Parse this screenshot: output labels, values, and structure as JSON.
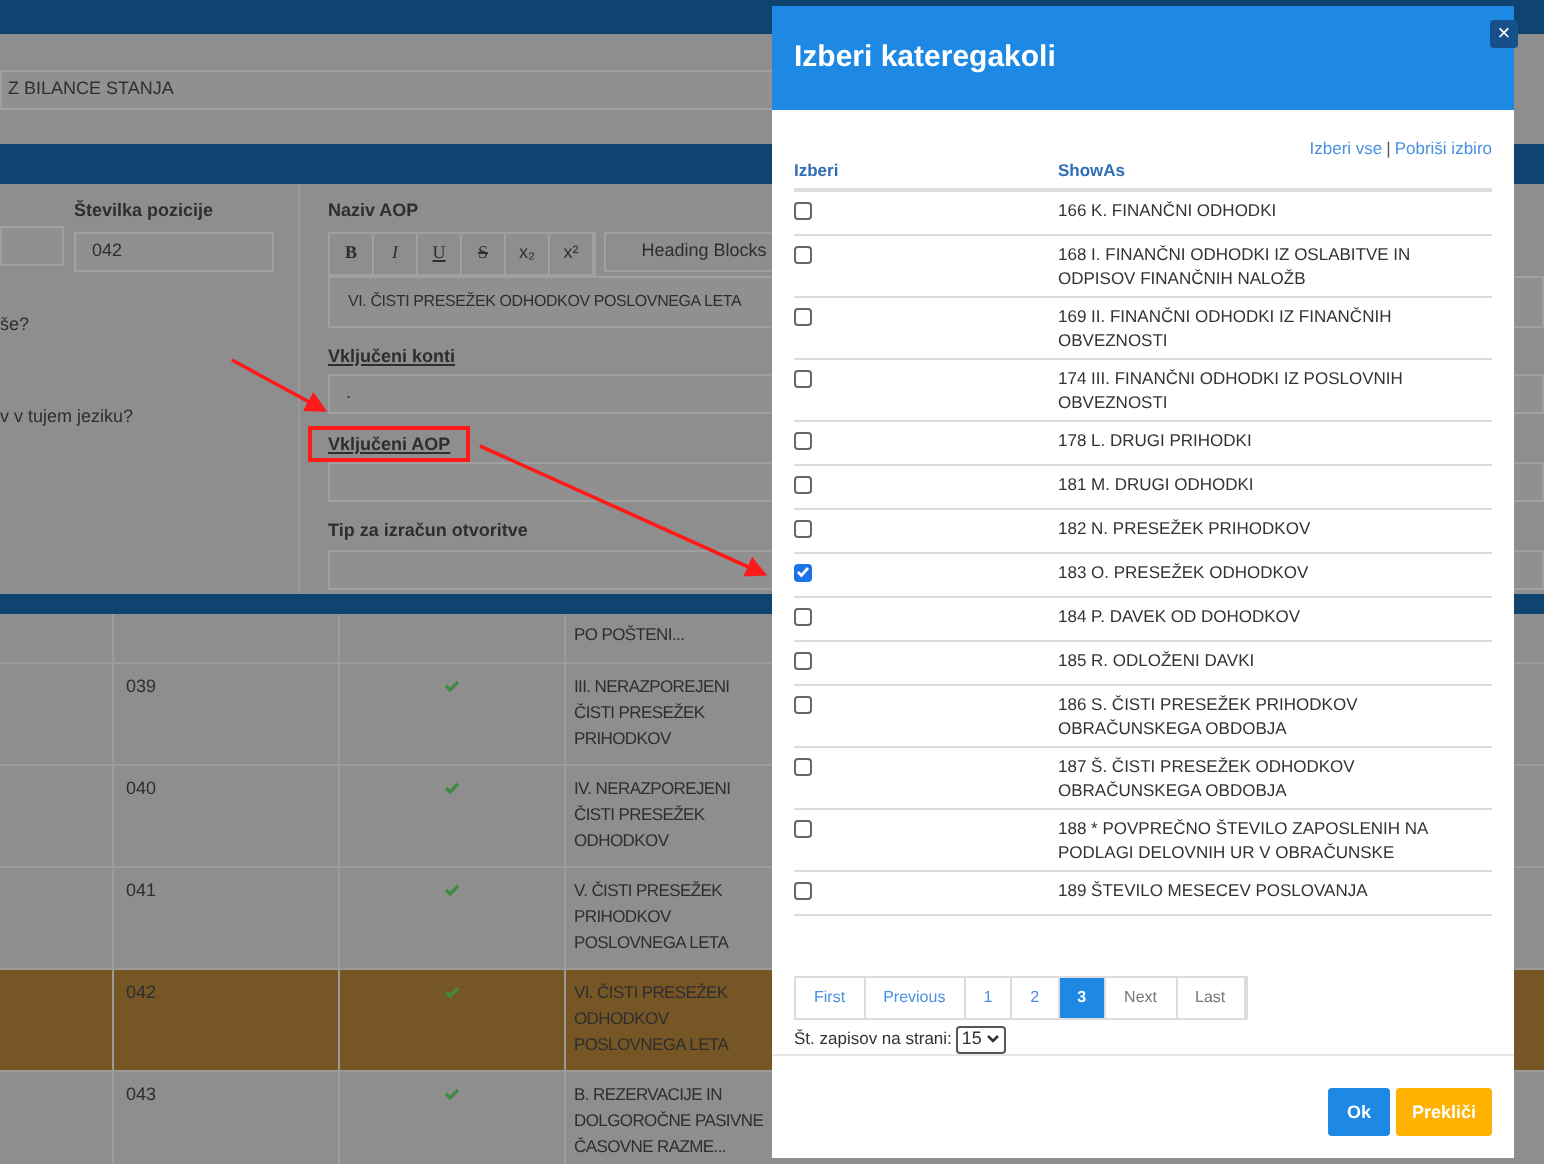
{
  "page": {
    "top_field": "Z BILANCE STANJA",
    "form": {
      "position_label": "Številka pozicije",
      "position_value": "042",
      "question_1": "še?",
      "question_2": "v v tujem jeziku?",
      "name_label": "Naziv AOP",
      "toolbar": [
        {
          "label": "B",
          "kind": "bold"
        },
        {
          "label": "I",
          "kind": "italic"
        },
        {
          "label": "U",
          "kind": "underline"
        },
        {
          "label": "S",
          "kind": "strike"
        },
        {
          "label": "x₂",
          "kind": "plain"
        },
        {
          "label": "x²",
          "kind": "plain"
        }
      ],
      "heading_select": "Heading Blocks",
      "name_value": "VI. ČISTI PRESEŽEK ODHODKOV POSLOVNEGA LETA",
      "accounts_label": "Vključeni konti",
      "accounts_value": ".",
      "aop_label": "Vključeni AOP",
      "tip_label": "Tip za izračun otvoritve"
    },
    "table": {
      "rows": [
        {
          "number": "",
          "checked": false,
          "name": "PO POŠTENI...",
          "selected": false
        },
        {
          "number": "039",
          "checked": true,
          "name": "III. NERAZPOREJENI ČISTI PRESEŽEK PRIHODKOV",
          "selected": false
        },
        {
          "number": "040",
          "checked": true,
          "name": "IV. NERAZPOREJENI ČISTI PRESEŽEK ODHODKOV",
          "selected": false
        },
        {
          "number": "041",
          "checked": true,
          "name": "V. ČISTI PRESEŽEK PRIHODKOV POSLOVNEGA LETA",
          "selected": false
        },
        {
          "number": "042",
          "checked": true,
          "name": "VI. ČISTI PRESEŽEK ODHODKOV POSLOVNEGA LETA",
          "selected": true
        },
        {
          "number": "043",
          "checked": true,
          "name": "B. REZERVACIJE IN DOLGOROČNE PASIVNE ČASOVNE RAZME...",
          "selected": false
        }
      ]
    }
  },
  "modal": {
    "title": "Izberi kateregakoli",
    "close": "×",
    "select_all": "Izberi vse",
    "separator": "|",
    "clear": "Pobriši izbiro",
    "columns": [
      "Izberi",
      "ShowAs"
    ],
    "items": [
      {
        "label": "166 K. FINANČNI ODHODKI",
        "checked": false
      },
      {
        "label": "168 I. FINANČNI ODHODKI IZ OSLABITVE IN ODPISOV FINANČNIH NALOŽB",
        "checked": false
      },
      {
        "label": "169 II. FINANČNI ODHODKI IZ FINANČNIH OBVEZNOSTI",
        "checked": false
      },
      {
        "label": "174 III. FINANČNI ODHODKI IZ POSLOVNIH OBVEZNOSTI",
        "checked": false
      },
      {
        "label": "178 L. DRUGI PRIHODKI",
        "checked": false
      },
      {
        "label": "181 M. DRUGI ODHODKI",
        "checked": false
      },
      {
        "label": "182 N. PRESEŽEK PRIHODKOV",
        "checked": false
      },
      {
        "label": "183 O. PRESEŽEK ODHODKOV",
        "checked": true
      },
      {
        "label": "184 P. DAVEK OD DOHODKOV",
        "checked": false
      },
      {
        "label": "185 R. ODLOŽENI DAVKI",
        "checked": false
      },
      {
        "label": "186 S. ČISTI PRESEŽEK PRIHODKOV OBRAČUNSKEGA OBDOBJA",
        "checked": false
      },
      {
        "label": "187 Š. ČISTI PRESEŽEK ODHODKOV OBRAČUNSKEGA OBDOBJA",
        "checked": false
      },
      {
        "label": "188 * POVPREČNO ŠTEVILO ZAPOSLENIH NA PODLAGI DELOVNIH UR V OBRAČUNSKE",
        "checked": false
      },
      {
        "label": "189 ŠTEVILO MESECEV POSLOVANJA",
        "checked": false
      }
    ],
    "pagination": [
      {
        "label": "First",
        "selected": false
      },
      {
        "label": "Previous",
        "selected": false
      },
      {
        "label": "1",
        "selected": false
      },
      {
        "label": "2",
        "selected": false
      },
      {
        "label": "3",
        "selected": true
      },
      {
        "label": "Next",
        "selected": false
      },
      {
        "label": "Last",
        "selected": false
      }
    ],
    "page_size_label": "Št. zapisov na strani:",
    "page_size": "15",
    "ok": "Ok",
    "cancel": "Prekliči"
  }
}
